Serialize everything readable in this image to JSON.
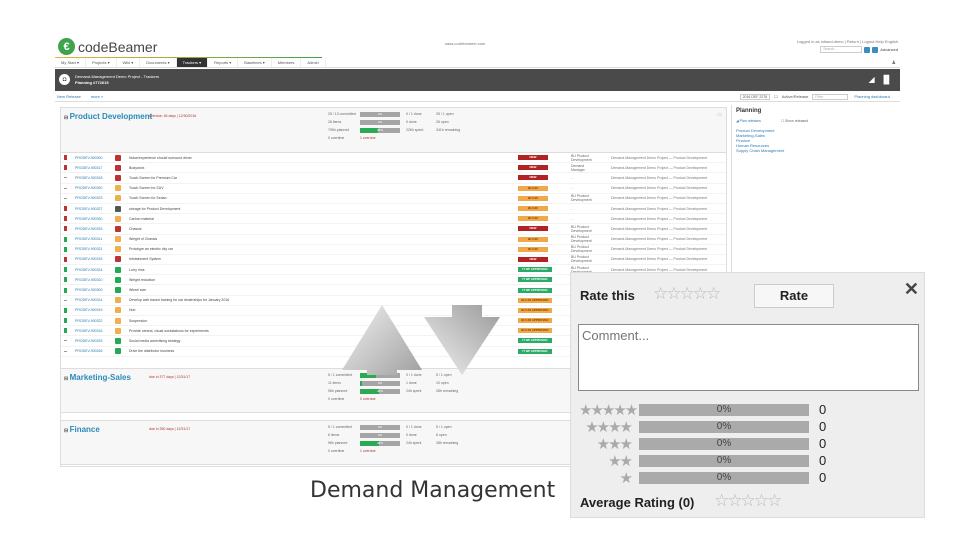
{
  "app": {
    "logo": "codeBeamer",
    "site_url": "saas.codebeamer.com",
    "user_links": "Logged in as intland.demo | Return | Logout  Help  English",
    "search_placeholder": "Search...",
    "advanced_label": "Advanced"
  },
  "nav": [
    {
      "label": "My Start ▾"
    },
    {
      "label": "Projects ▾"
    },
    {
      "label": "Wiki ▾"
    },
    {
      "label": "Documents ▾"
    },
    {
      "label": "Trackers ▾",
      "active": true
    },
    {
      "label": "Reports ▾"
    },
    {
      "label": "Baselines ▾"
    },
    {
      "label": "Members"
    },
    {
      "label": "Admin"
    }
  ],
  "header": {
    "title": "Demand-Management Demo Project - Trackers",
    "subtitle": "Planning  #772615"
  },
  "subbar": {
    "new_link": "New Release",
    "more_link": "more »",
    "date": "2016 DEF 2278",
    "active_label": "Active/Release",
    "filter_placeholder": "Filter",
    "right_link": "Planning dashboard"
  },
  "panels": [
    {
      "title": "Product Development",
      "meta": "overdue: 46 days  |  12/30/2016",
      "stats": [
        {
          "left": "25 / 13 committed",
          "bar_text": "0%",
          "fill": 0,
          "mid": "0 / 1 done",
          "right": "25 / 1 open"
        },
        {
          "left": "26 items",
          "bar_text": "0%",
          "fill": 0,
          "mid": "0 done",
          "right": "26 open"
        },
        {
          "left": "795h planned",
          "bar_text": "46%",
          "fill": 0.46,
          "mid": "226h spent",
          "right": "341h remaining"
        },
        {
          "left": "0 overtime",
          "bar_text": "",
          "fill": null,
          "mid": "1 overdue",
          "right": ""
        }
      ]
    },
    {
      "title": "Marketing-Sales",
      "meta": "due in 377 days  |  12/31/17",
      "stats": [
        {
          "left": "5 / 1 committed",
          "bar_text": "",
          "fill": 0.4,
          "mid": "0 / 1 done",
          "right": "5 / 1 open"
        },
        {
          "left": "11 items",
          "bar_text": "4%",
          "fill": 0.04,
          "mid": "1 done",
          "right": "10 open"
        },
        {
          "left": "96h planned",
          "bar_text": "48%",
          "fill": 0.48,
          "mid": "24h spent",
          "right": "28h remaining"
        },
        {
          "left": "0 overtime",
          "bar_text": "",
          "fill": null,
          "mid": "0 overdue",
          "right": ""
        }
      ]
    },
    {
      "title": "Finance",
      "meta": "due in 350 days  |  12/31/17",
      "stats": [
        {
          "left": "5 / 1 committed",
          "bar_text": "0%",
          "fill": 0,
          "mid": "0 / 1 done",
          "right": "5 / 1 open"
        },
        {
          "left": "6 items",
          "bar_text": "0%",
          "fill": 0,
          "mid": "0 done",
          "right": "6 open"
        },
        {
          "left": "96h planned",
          "bar_text": "48%",
          "fill": 0.48,
          "mid": "24h spent",
          "right": "28h remaining"
        },
        {
          "left": "0 overtime",
          "bar_text": "",
          "fill": null,
          "mid": "1 overdue",
          "right": ""
        }
      ]
    }
  ],
  "rows": [
    {
      "id": "PRODEV-900300",
      "prio": "#b33",
      "icon": "#b33",
      "name": "Noise/experience should surround driver",
      "status": "NEW",
      "status_color": "#b22222",
      "field": "BU Product Development",
      "project": "Demand-Management Demo Project — Product Development"
    },
    {
      "id": "PRODEV-900317",
      "prio": "#b33",
      "icon": "#b33",
      "name": "Bodywork",
      "status": "NEW",
      "status_color": "#b22222",
      "field": "Demand Manager",
      "project": "Demand-Management Demo Project — Product Development"
    },
    {
      "id": "PRODEV-900318",
      "prio": "#999",
      "icon": "#b33",
      "name": "Touch Screen for Premium Car",
      "status": "NEW",
      "status_color": "#b22222",
      "field": "-",
      "project": "Demand-Management Demo Project — Product Development"
    },
    {
      "id": "PRODEV-900320",
      "prio": "#999",
      "icon": "#f0b050",
      "name": "Touch Screen for SUV",
      "status": "BU HO",
      "status_color": "#f0a848",
      "field": "-",
      "project": "Demand-Management Demo Project — Product Development"
    },
    {
      "id": "PRODEV-900323",
      "prio": "#999",
      "icon": "#f0b050",
      "name": "Touch Screen for Sedan",
      "status": "BU HO",
      "status_color": "#f0a848",
      "field": "BU Product Development",
      "project": "Demand-Management Demo Project — Product Development"
    },
    {
      "id": "PRODEV-900327",
      "prio": "#b33",
      "icon": "#555",
      "name": "storage for Product Development",
      "status": "BU HO",
      "status_color": "#f0a848",
      "field": "-",
      "project": "Demand-Management Demo Project — Product Development"
    },
    {
      "id": "PRODEV-900330",
      "prio": "#b33",
      "icon": "#f0b050",
      "name": "Carbon material",
      "status": "BU HO",
      "status_color": "#f0a848",
      "field": "-",
      "project": "Demand-Management Demo Project — Product Development"
    },
    {
      "id": "PRODEV-900333",
      "prio": "#b33",
      "icon": "#b33",
      "name": "Chassis",
      "status": "NEW",
      "status_color": "#b22222",
      "field": "BU Product Development",
      "project": "Demand-Management Demo Project — Product Development"
    },
    {
      "id": "PRODEV-900311",
      "prio": "#2a5",
      "icon": "#f0b050",
      "name": "Weight of Chassis",
      "status": "BU HO",
      "status_color": "#f0a848",
      "field": "BU Product Development",
      "project": "Demand-Management Demo Project — Product Development"
    },
    {
      "id": "PRODEV-900321",
      "prio": "#2a5",
      "icon": "#f0b050",
      "name": "Prototype an electric city car",
      "status": "BU HO",
      "status_color": "#f0a848",
      "field": "BU Product Development",
      "project": "Demand-Management Demo Project — Product Development"
    },
    {
      "id": "PRODEV-900315",
      "prio": "#b33",
      "icon": "#b33",
      "name": "Infotainment System",
      "status": "NEW",
      "status_color": "#b22222",
      "field": "BU Product Development",
      "project": "Demand-Management Demo Project — Product Development"
    },
    {
      "id": "PRODEV-900324",
      "prio": "#2a5",
      "icon": "#2a5",
      "name": "Lorry rims",
      "status": "IT BP APPROVED",
      "status_color": "#2aaa66",
      "field": "BU Product Development",
      "project": "Demand-Management Demo Project — Product Development"
    },
    {
      "id": "PRODEV-900310",
      "prio": "#2a5",
      "icon": "#2a5",
      "name": "Weight reduction",
      "status": "IT BP APPROVED",
      "status_color": "#2aaa66",
      "field": "",
      "project": ""
    },
    {
      "id": "PRODEV-900309",
      "prio": "#2a5",
      "icon": "#2a5",
      "name": "Wheel size",
      "status": "IT BP APPROVED",
      "status_color": "#2aaa66",
      "field": "",
      "project": ""
    },
    {
      "id": "PRODEV-900314",
      "prio": "#999",
      "icon": "#f0b050",
      "name": "Develop web based training for car dealerships for January 2016",
      "status": "BU HO APPROVED",
      "status_color": "#f0a848",
      "field": "",
      "project": ""
    },
    {
      "id": "PRODEV-900319",
      "prio": "#2a5",
      "icon": "#f0b050",
      "name": "Hub",
      "status": "BU HO APPROVED",
      "status_color": "#f0a848",
      "field": "",
      "project": ""
    },
    {
      "id": "PRODEV-900322",
      "prio": "#2a5",
      "icon": "#f0b050",
      "name": "Suspension",
      "status": "BU HO APPROVED",
      "status_color": "#f0a848",
      "field": "",
      "project": ""
    },
    {
      "id": "PRODEV-900316",
      "prio": "#2a5",
      "icon": "#f0b050",
      "name": "Provide central, visual workstations for experiments",
      "status": "BU HO APPROVED",
      "status_color": "#f0a848",
      "field": "",
      "project": ""
    },
    {
      "id": "PRODEV-900325",
      "prio": "#999",
      "icon": "#2a5",
      "name": "Social media advertising strategy",
      "status": "IT BP APPROVED",
      "status_color": "#2aaa66",
      "field": "",
      "project": ""
    },
    {
      "id": "PRODEV-900326",
      "prio": "#999",
      "icon": "#2a5",
      "name": "Drive the distributor business",
      "status": "IT BP APPROVED",
      "status_color": "#2aaa66",
      "field": "",
      "project": ""
    }
  ],
  "sidebar": {
    "title": "Planning",
    "option_plan": "Plan releases",
    "option_show": "Show released",
    "links": [
      "Product Development",
      "Marketing-Sales",
      "Finance",
      "Human Resources",
      "Supply Chain Management"
    ]
  },
  "caption": "Demand Management",
  "rating": {
    "rate_this_label": "Rate this",
    "rate_button": "Rate",
    "comment_placeholder": "Comment...",
    "distribution": [
      {
        "stars": "★★★★★",
        "percent": "0%",
        "count": "0"
      },
      {
        "stars": "★★★★",
        "percent": "0%",
        "count": "0"
      },
      {
        "stars": "★★★",
        "percent": "0%",
        "count": "0"
      },
      {
        "stars": "★★",
        "percent": "0%",
        "count": "0"
      },
      {
        "stars": "★",
        "percent": "0%",
        "count": "0"
      }
    ],
    "average_label": "Average Rating (0)",
    "empty_stars": "☆☆☆☆☆"
  }
}
